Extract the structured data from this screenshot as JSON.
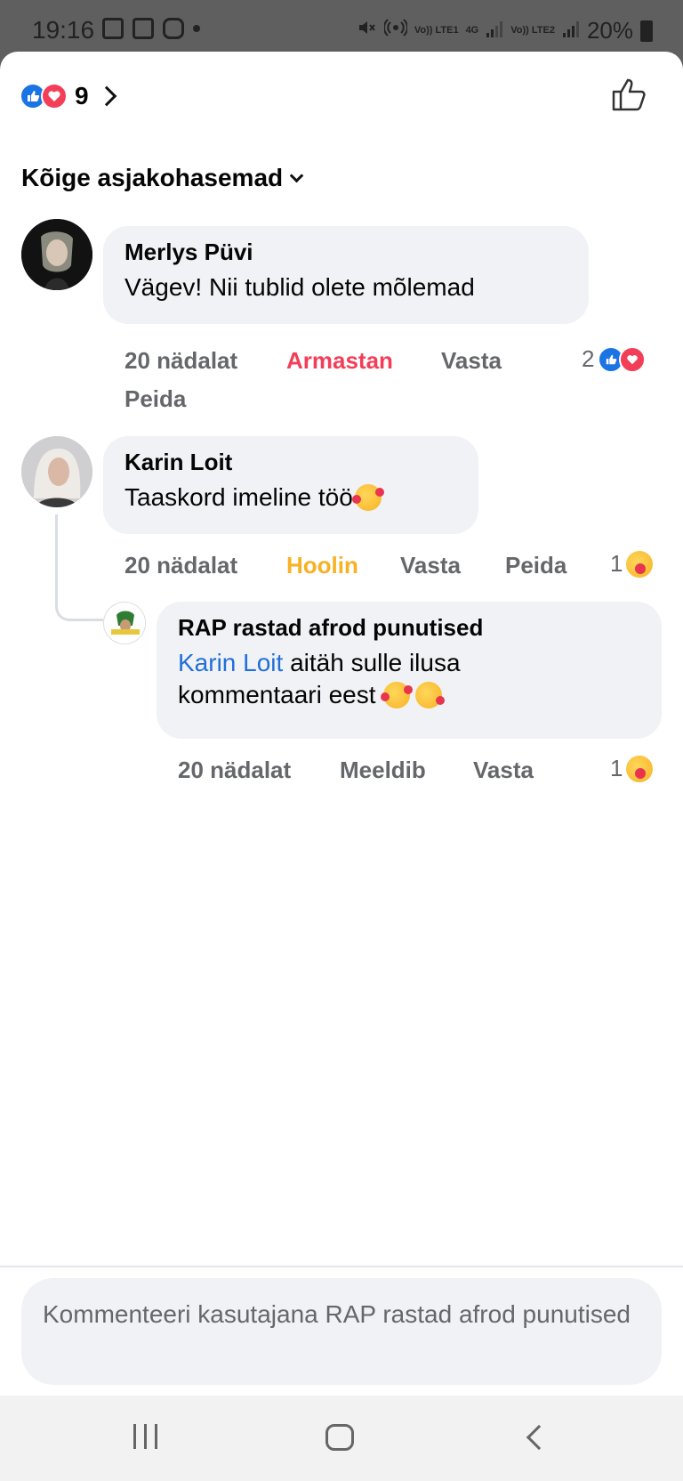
{
  "status_bar": {
    "time": "19:16",
    "left_icons": [
      "gallery-icon",
      "video-icon",
      "instagram-icon",
      "dot-icon"
    ],
    "right_icons": [
      "mute-icon",
      "hotspot-icon",
      "volte-lte1-icon",
      "4g-icon",
      "signal-icon",
      "volte-lte2-icon",
      "signal-icon",
      "battery-icon"
    ],
    "lte1_label": "Vo)) LTE1",
    "network": "4G",
    "lte2_label": "Vo)) LTE2",
    "battery": "20%"
  },
  "header": {
    "reaction_count": "9",
    "reaction_icons": [
      "like",
      "love"
    ]
  },
  "sort": {
    "label": "Kõige asjakohasemad"
  },
  "comments": [
    {
      "author": "Merlys Püvi",
      "text": "Vägev! Nii tublid olete mõlemad",
      "time": "20 nädalat",
      "my_reaction": "Armastan",
      "reply": "Vasta",
      "hide": "Peida",
      "reaction_count": "2",
      "reaction_types": [
        "like",
        "love"
      ]
    },
    {
      "author": "Karin Loit",
      "text": "Taaskord imeline töö",
      "emoji": "smiling-face-with-hearts",
      "time": "20 nädalat",
      "my_reaction": "Hoolin",
      "reply": "Vasta",
      "hide": "Peida",
      "reaction_count": "1",
      "reaction_types": [
        "care"
      ],
      "replies": [
        {
          "author": "RAP rastad afrod punutised",
          "mention": "Karin Loit",
          "text_line1": " aitäh sulle ilusa",
          "text_line2": "kommentaari eest",
          "emojis": [
            "smiling-face-with-hearts",
            "face-blowing-kiss"
          ],
          "time": "20 nädalat",
          "like": "Meeldib",
          "reply": "Vasta",
          "reaction_count": "1",
          "reaction_types": [
            "care"
          ]
        }
      ]
    }
  ],
  "composer": {
    "placeholder": "Kommenteeri kasutajana RAP rastad afrod punutised"
  },
  "colors": {
    "like_blue": "#1b74e4",
    "love_red": "#f33e58",
    "care_yellow": "#f7b125",
    "mention_blue": "#216fdb",
    "meta_gray": "#65676b",
    "bubble_bg": "#f0f2f5"
  }
}
